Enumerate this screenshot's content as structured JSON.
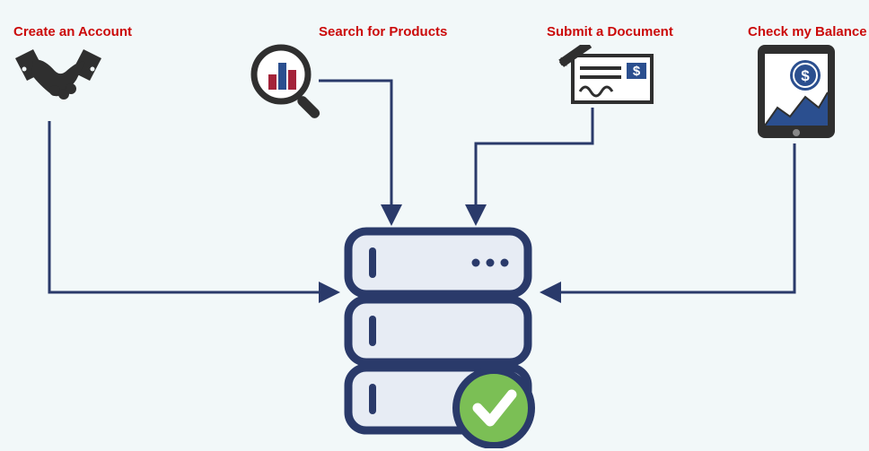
{
  "nodes": {
    "create_account": {
      "label": "Create an Account"
    },
    "search_products": {
      "label": "Search for Products"
    },
    "submit_document": {
      "label": "Submit a Document"
    },
    "check_balance": {
      "label": "Check my Balance"
    }
  },
  "target": {
    "name": "server"
  },
  "colors": {
    "label": "#cb0a0a",
    "stroke": "#2a3a6a",
    "accent_red": "#a4233a",
    "accent_blue": "#2b4f8f",
    "check_green": "#7bbf55"
  }
}
